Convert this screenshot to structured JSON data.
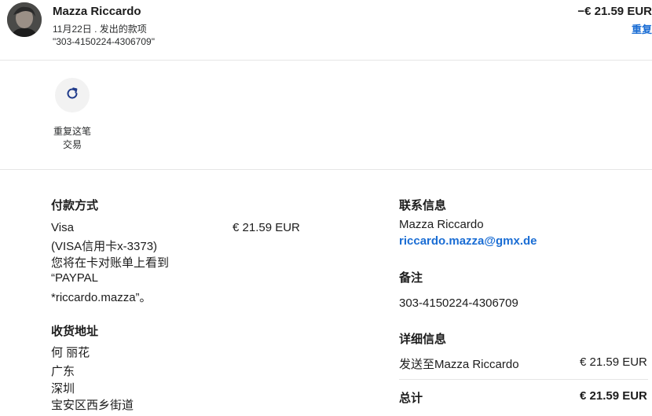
{
  "header": {
    "name": "Mazza Riccardo",
    "date_line": "11月22日 . 发出的款项",
    "reference": "\"303-4150224-4306709\"",
    "amount": "−€ 21.59 EUR",
    "repeat_link": "重复"
  },
  "action": {
    "icon": "refresh-icon",
    "label_line1": "重复这笔",
    "label_line2": "交易"
  },
  "payment": {
    "heading": "付款方式",
    "method": "Visa",
    "card_line": "(VISA信用卡x-3373)",
    "note_line1": "您将在卡对账单上看到",
    "note_line2": "“PAYPAL",
    "note_line3": "*riccardo.mazza”。",
    "amount": "€ 21.59 EUR"
  },
  "shipping": {
    "heading": "收货地址",
    "lines": [
      "何 丽花",
      "广东",
      "深圳",
      "宝安区西乡街道"
    ]
  },
  "contact": {
    "heading": "联系信息",
    "name": "Mazza Riccardo",
    "email": "riccardo.mazza@gmx.de"
  },
  "notes": {
    "heading": "备注",
    "value": "303-4150224-4306709"
  },
  "details": {
    "heading": "详细信息",
    "line_label": "发送至Mazza Riccardo",
    "line_amount": "€ 21.59 EUR",
    "total_label": "总计",
    "total_amount": "€ 21.59 EUR"
  },
  "colors": {
    "link": "#1a6dd4",
    "divider": "#e6e6e6",
    "icon_bg": "#f2f2f2"
  }
}
